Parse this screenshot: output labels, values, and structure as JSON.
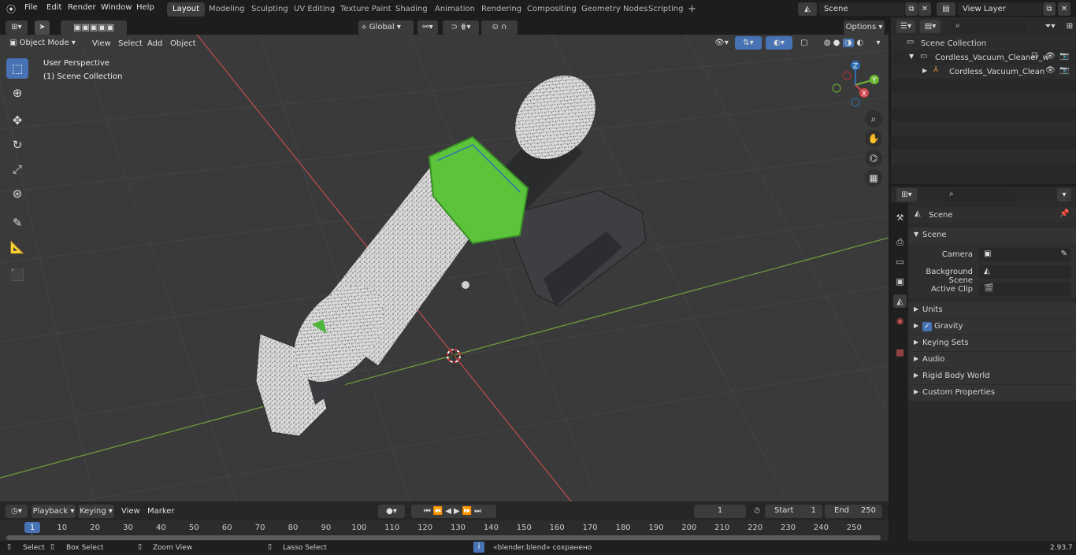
{
  "menu": [
    "File",
    "Edit",
    "Render",
    "Window",
    "Help"
  ],
  "workspaces": [
    "Layout",
    "Modeling",
    "Sculpting",
    "UV Editing",
    "Texture Paint",
    "Shading",
    "Animation",
    "Rendering",
    "Compositing",
    "Geometry Nodes",
    "Scripting"
  ],
  "scene_name": "Scene",
  "view_layer": "View Layer",
  "viewport": {
    "mode": "Object Mode",
    "menus": [
      "View",
      "Select",
      "Add",
      "Object"
    ],
    "orientation": "Global",
    "options": "Options",
    "overlay_line1": "User Perspective",
    "overlay_line2": "(1) Scene Collection"
  },
  "gizmo": {
    "x": "X",
    "y": "Y",
    "z": "Z"
  },
  "outliner": {
    "root": "Scene Collection",
    "item1": "Cordless_Vacuum_Cleaner_w",
    "item2": "Cordless_Vacuum_Clean"
  },
  "props": {
    "header": "Scene",
    "section": "Scene",
    "camera_label": "Camera",
    "bg_label": "Background Scene",
    "clip_label": "Active Clip",
    "panels": [
      "Units",
      "Gravity",
      "Keying Sets",
      "Audio",
      "Rigid Body World",
      "Custom Properties"
    ]
  },
  "timeline": {
    "menus": [
      "Playback",
      "Keying",
      "View",
      "Marker"
    ],
    "current_frame": "1",
    "start_label": "Start",
    "start": "1",
    "end_label": "End",
    "end": "250",
    "ticks": [
      "1",
      "10",
      "20",
      "30",
      "40",
      "50",
      "60",
      "70",
      "80",
      "90",
      "100",
      "110",
      "120",
      "130",
      "140",
      "150",
      "160",
      "170",
      "180",
      "190",
      "200",
      "210",
      "220",
      "230",
      "240",
      "250"
    ]
  },
  "status": {
    "select": "Select",
    "box_select": "Box Select",
    "zoom_view": "Zoom View",
    "lasso_select": "Lasso Select",
    "message": "«blender.blend» сохранено",
    "version": "2.93.7"
  },
  "colors": {
    "accent": "#4772b3",
    "green_part": "#5cc43a",
    "x_axis": "#d3474f",
    "y_axis": "#6bb633"
  }
}
